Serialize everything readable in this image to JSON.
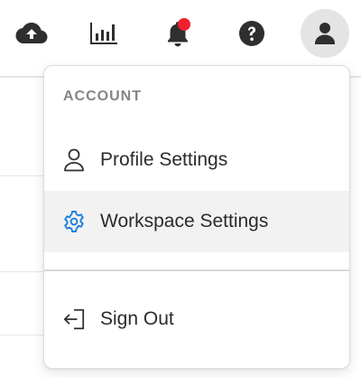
{
  "toolbar": {
    "icons": [
      "cloud-upload-icon",
      "bar-chart-icon",
      "bell-icon",
      "help-icon",
      "user-icon"
    ],
    "notification_dot_color": "#f0212f"
  },
  "menu": {
    "section_label": "ACCOUNT",
    "items": [
      {
        "label": "Profile Settings",
        "icon": "user-outline-icon"
      },
      {
        "label": "Workspace Settings",
        "icon": "gear-icon",
        "highlighted": true
      },
      {
        "label": "Sign Out",
        "icon": "sign-out-icon"
      }
    ]
  },
  "colors": {
    "icon_dark": "#2f2f2f",
    "accent_blue": "#1a7fe0",
    "highlight_bg": "#f2f2f2"
  }
}
